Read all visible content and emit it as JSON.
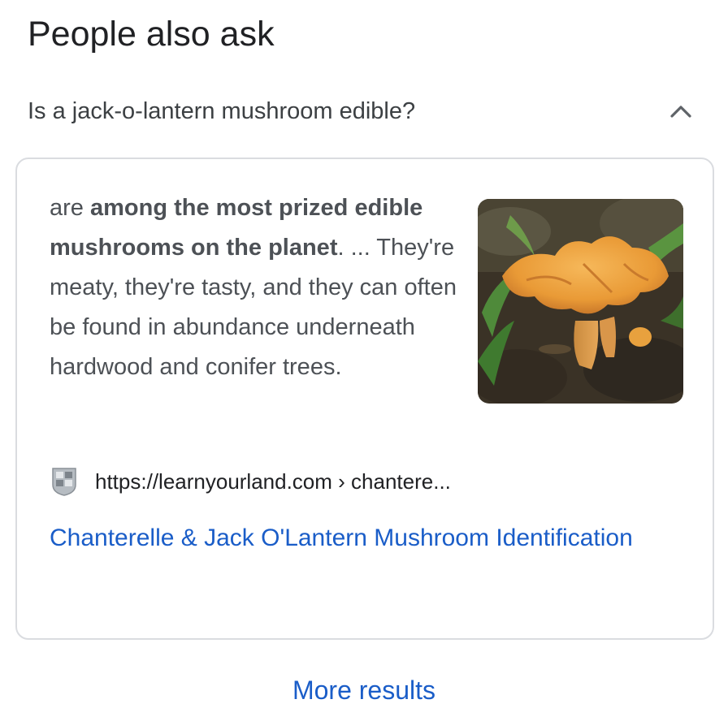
{
  "section": {
    "title": "People also ask"
  },
  "question": {
    "text": "Is a jack-o-lantern mushroom edible?",
    "expanded_icon": "chevron-up-icon"
  },
  "answer": {
    "snippet_prefix": "are ",
    "snippet_bold": "among the most prized edible mushrooms on the planet",
    "snippet_rest": ". ... They're meaty, they're tasty, and they can often be found in abundance underneath hardwood and conifer trees.",
    "image_alt": "orange chanterelle mushroom",
    "source_url": "https://learnyourland.com › chantere...",
    "link_title": "Chanterelle & Jack O'Lantern Mushroom Identification"
  },
  "footer": {
    "more_results": "More results"
  },
  "colors": {
    "link": "#1a5dc8",
    "text": "#4d5156",
    "border": "#dadce0"
  }
}
